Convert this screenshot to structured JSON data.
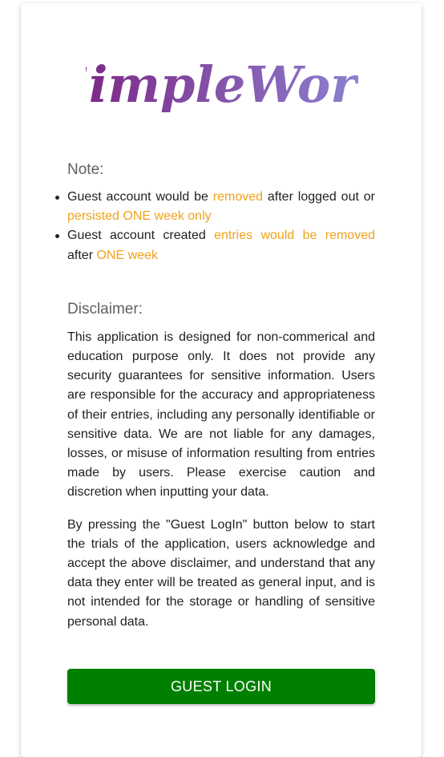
{
  "brand": {
    "name": "SimpleWork",
    "gradient_start": "#7a1f7e",
    "gradient_end": "#8e8ad8"
  },
  "note": {
    "title": "Note:",
    "items": [
      {
        "text_before": "Guest account would be ",
        "highlight1": "removed",
        "text_middle": " after logged out or ",
        "highlight2": "persisted ONE week only"
      },
      {
        "text_before": "Guest account created ",
        "highlight1": "entries would be removed",
        "text_middle": " after ",
        "highlight2": "ONE week"
      }
    ],
    "highlight_color": "#f0a21a"
  },
  "disclaimer": {
    "title": "Disclaimer:",
    "paragraphs": [
      "This application is designed for non-commerical and education purpose only. It does not provide any security guarantees for sensitive information. Users are responsible for the accuracy and appropriateness of their entries, including any personally identifiable or sensitive data. We are not liable for any damages, losses, or misuse of information resulting from entries made by users. Please exercise caution and discretion when inputting your data.",
      "By pressing the \"Guest LogIn\" button below to start the trials of the application, users acknowledge and accept the above disclaimer, and understand that any data they enter will be treated as general input, and is not intended for the storage or handling of sensitive personal data."
    ]
  },
  "actions": {
    "guest_login_label": "GUEST LOGIN",
    "button_color": "#008000"
  }
}
